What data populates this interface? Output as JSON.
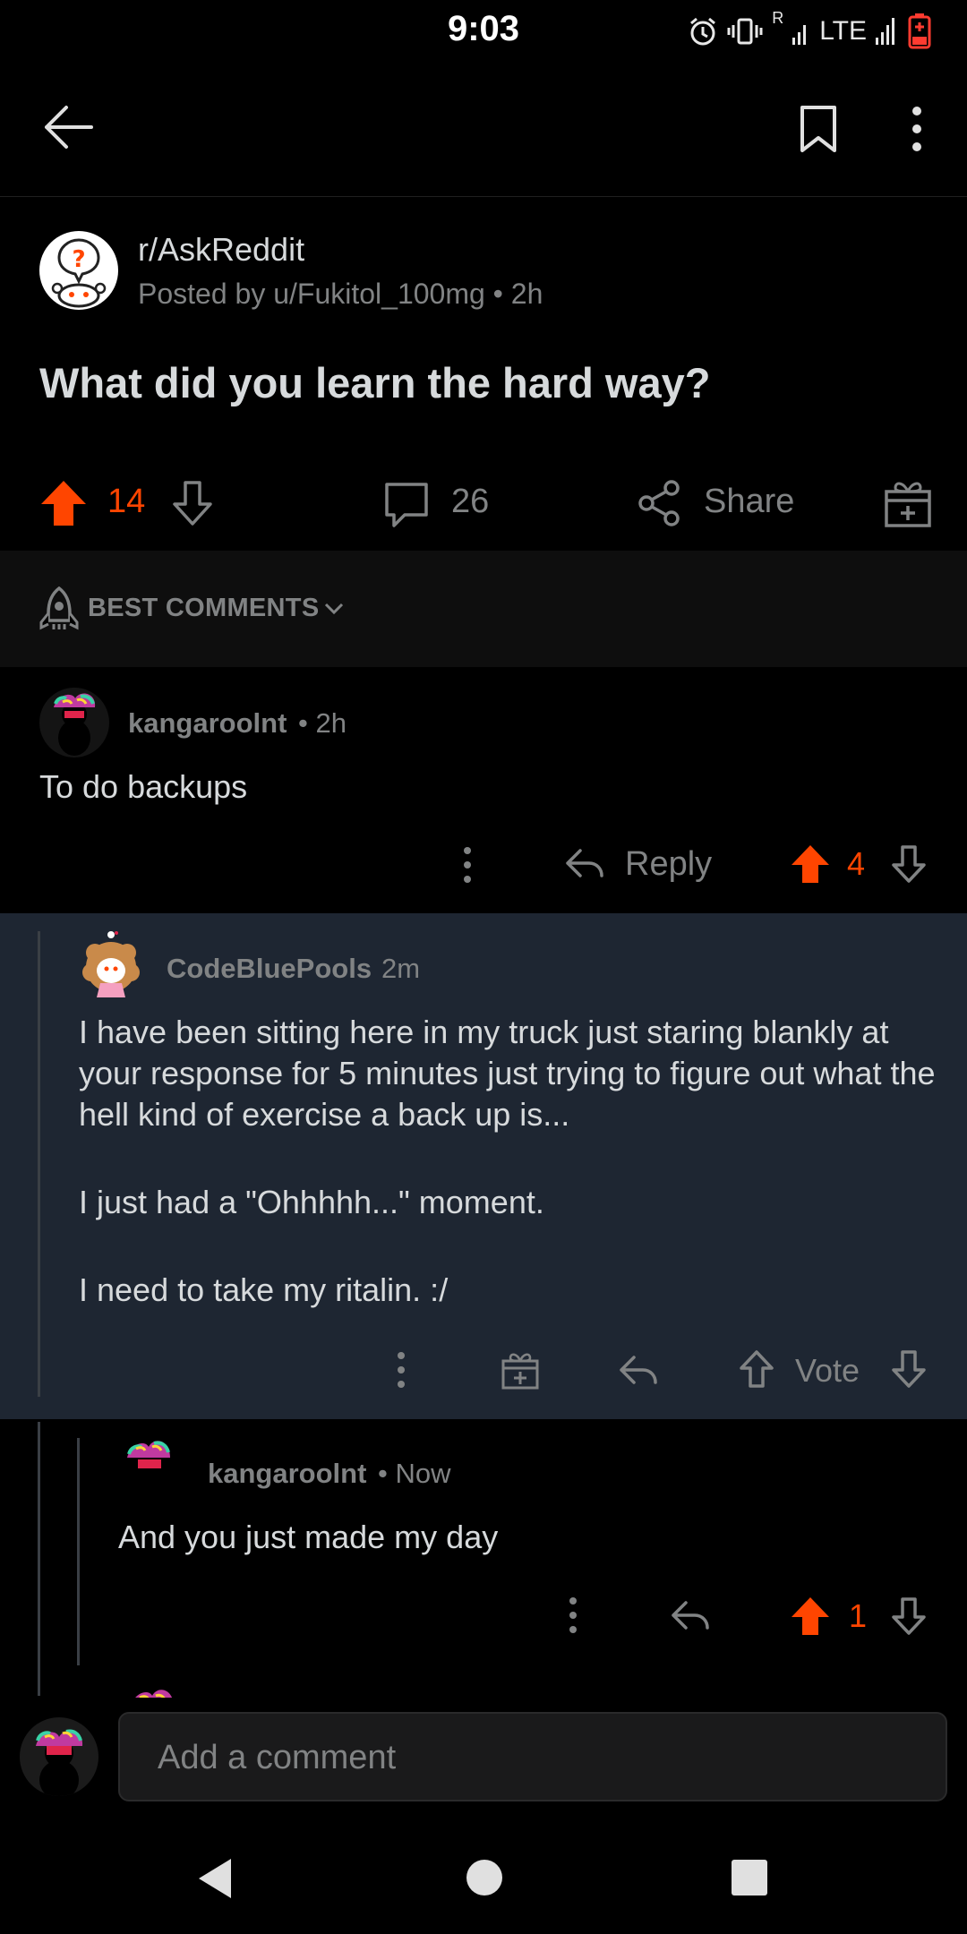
{
  "status_bar": {
    "time": "9:03",
    "network": "LTE",
    "roaming": "R"
  },
  "post": {
    "subreddit": "r/AskReddit",
    "posted_by": "Posted by u/Fukitol_100mg",
    "age": "2h",
    "title": "What did you learn the hard way?",
    "upvotes": "14",
    "comments": "26",
    "share_label": "Share"
  },
  "sort": {
    "label": "BEST COMMENTS"
  },
  "comments": [
    {
      "author": "kangaroolnt",
      "age": "2h",
      "body": "To do backups",
      "reply_label": "Reply",
      "score": "4"
    },
    {
      "author": "CodeBluePools",
      "age": "2m",
      "paragraphs": [
        "I have been sitting here in my truck just staring blankly at your response for 5 minutes just trying to figure out what the hell kind of exercise a back up is...",
        "I just had a \"Ohhhhh...\"  moment.",
        "I need to take my ritalin.  :/"
      ],
      "vote_label": "Vote"
    },
    {
      "author": "kangaroolnt",
      "age": "Now",
      "body": "And you just made my day",
      "score": "1"
    }
  ],
  "input": {
    "placeholder": "Add a comment"
  },
  "colors": {
    "accent": "#ff4500",
    "background": "#000000",
    "nested_highlight": "#1e2632",
    "text": "#d7dadc",
    "muted": "#818384"
  }
}
